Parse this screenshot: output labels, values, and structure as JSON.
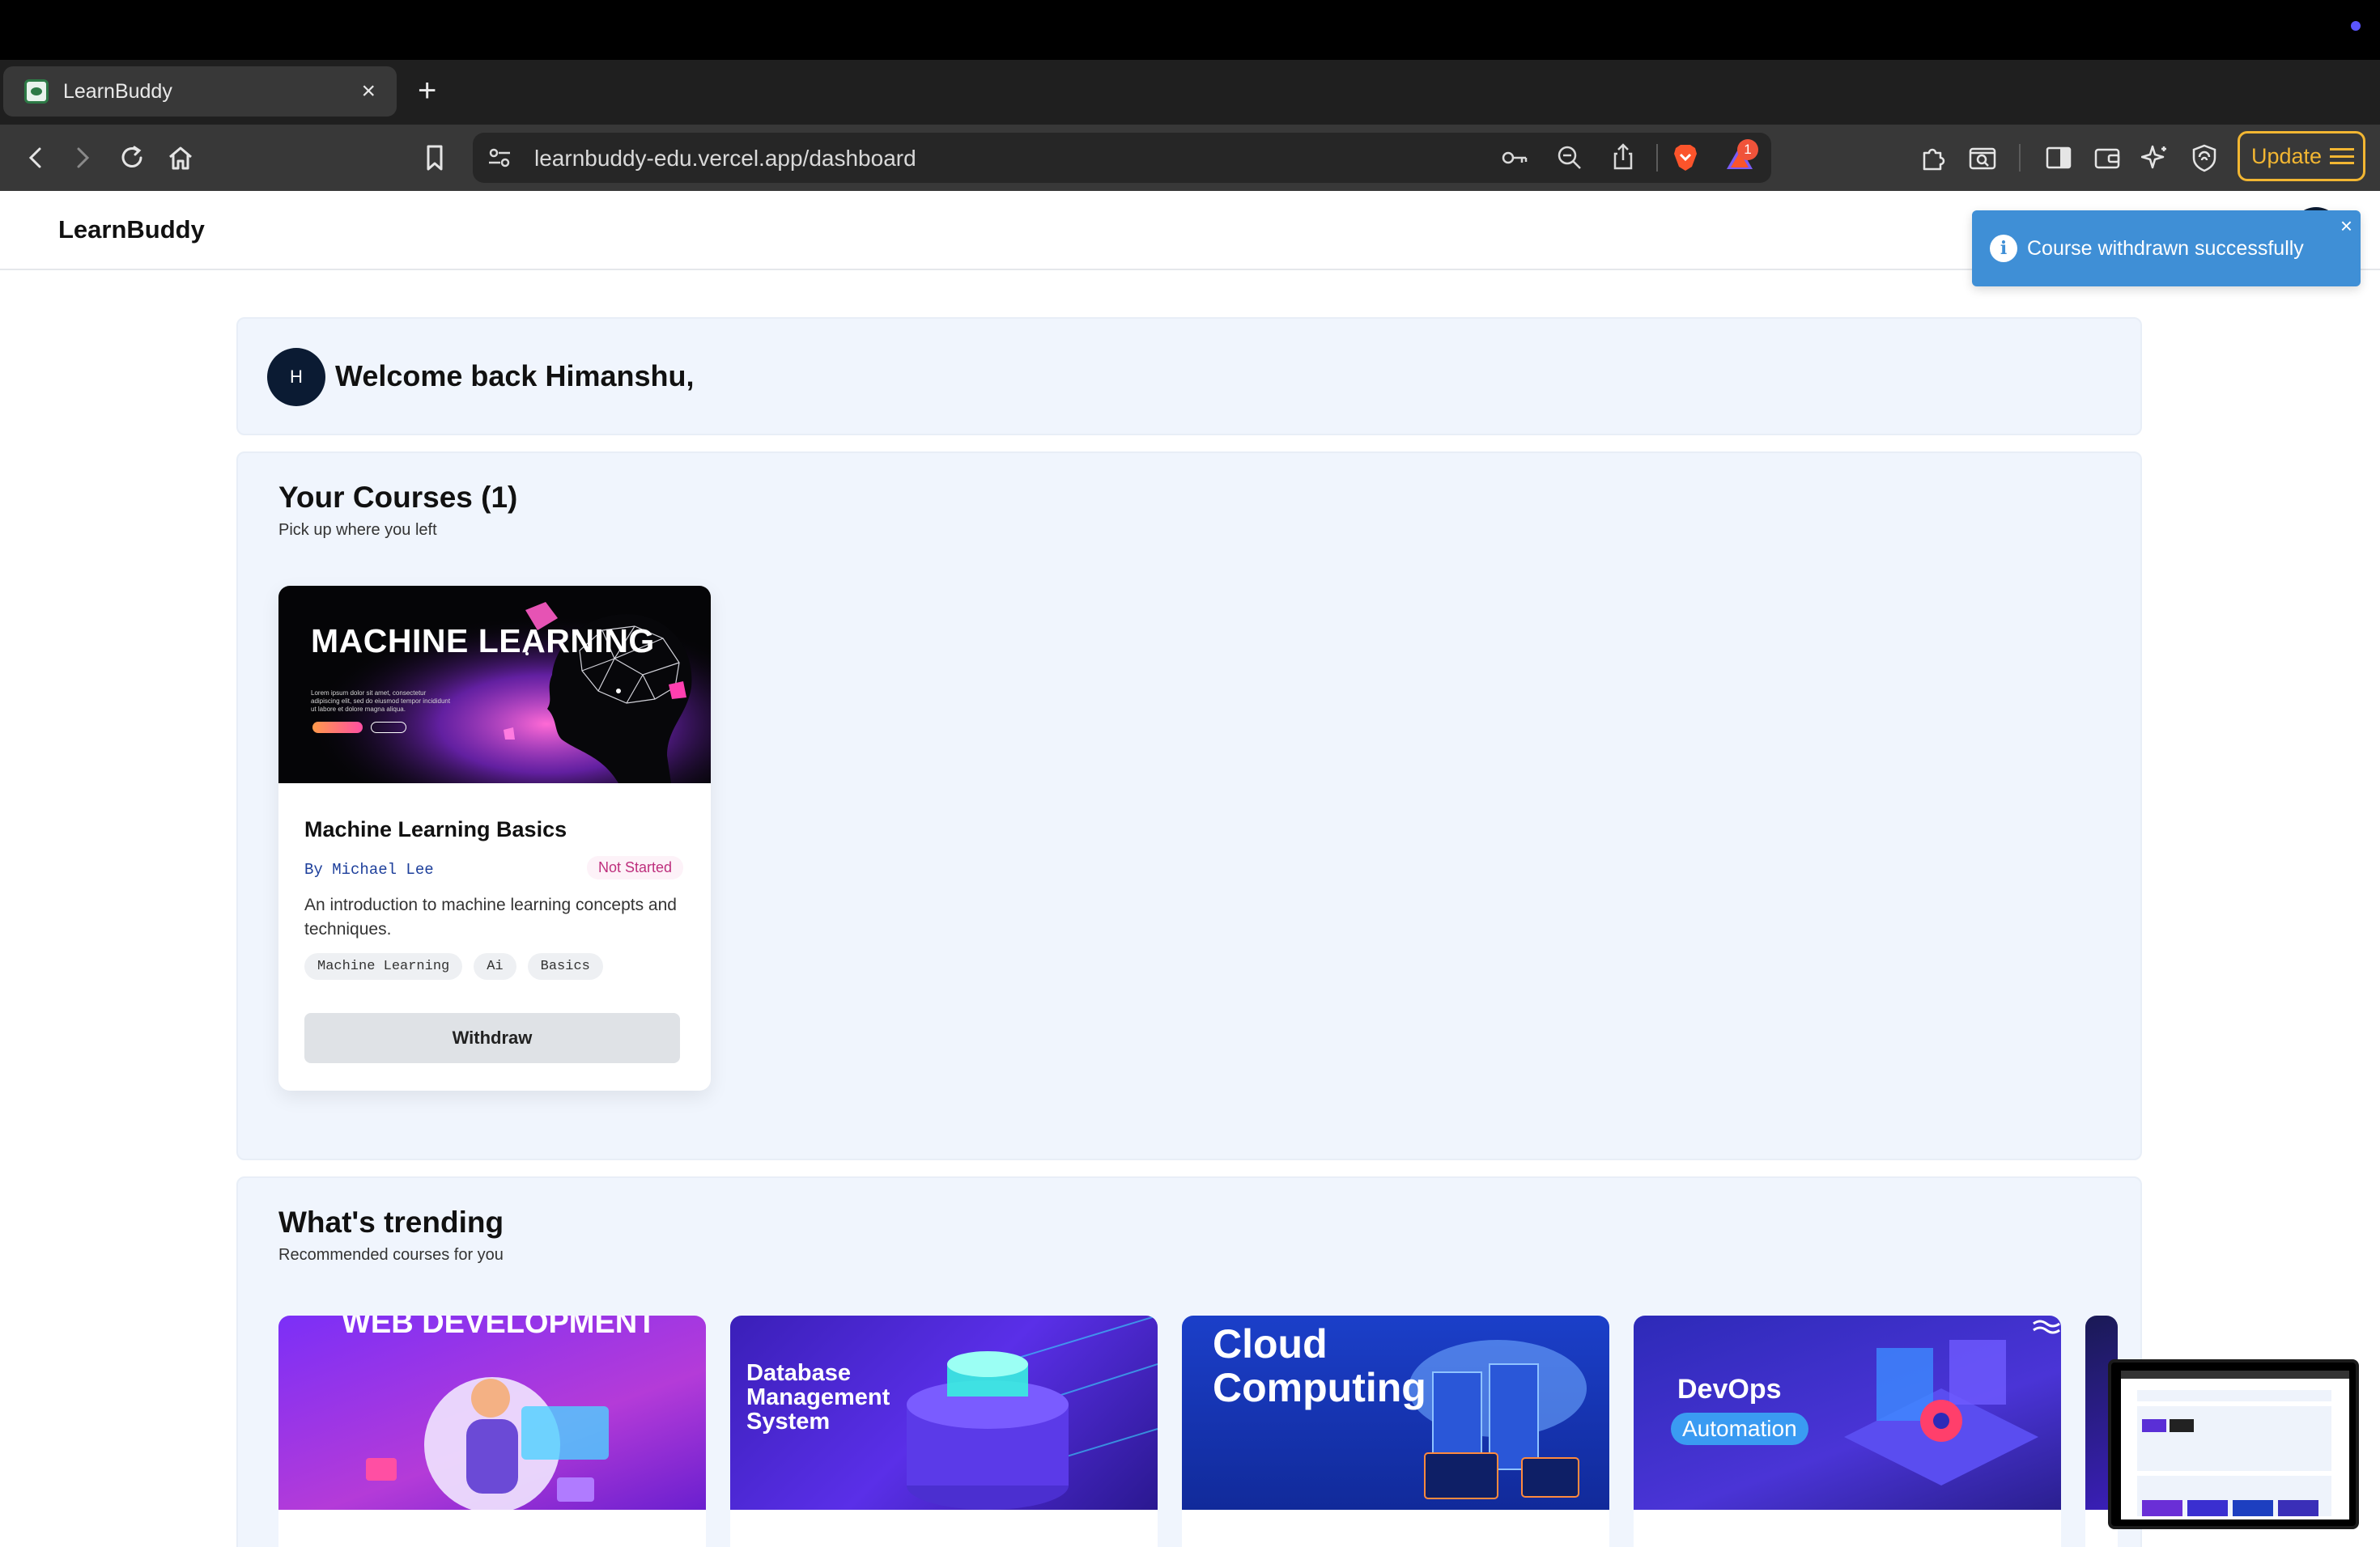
{
  "browser": {
    "tab_title": "LearnBuddy",
    "new_tab_symbol": "+",
    "close_symbol": "×",
    "url": "learnbuddy-edu.vercel.app/dashboard",
    "notification_count": "1",
    "update_label": "Update"
  },
  "app": {
    "brand": "LearnBuddy"
  },
  "toast": {
    "message": "Course withdrawn successfully",
    "close_symbol": "×",
    "info_symbol": "i"
  },
  "welcome": {
    "avatar_initial": "H",
    "greeting": "Welcome back Himanshu,"
  },
  "courses_section": {
    "title": "Your Courses (1)",
    "subtitle": "Pick up where you left",
    "courses": [
      {
        "thumbnail_text": "MACHINE LEARNING",
        "thumbnail_lorem": "Lorem ipsum dolor sit amet, consectetur adipiscing elit, sed do eiusmod tempor incididunt ut labore et dolore magna aliqua.",
        "thumbnail_btn1": "TRY FOR FREE",
        "thumbnail_btn2": "LOG IN",
        "name": "Machine Learning Basics",
        "author": "By Michael Lee",
        "status": "Not Started",
        "description": "An introduction to machine learning concepts and techniques.",
        "tags": [
          "Machine Learning",
          "Ai",
          "Basics"
        ],
        "action": "Withdraw"
      }
    ]
  },
  "trending_section": {
    "title": "What's trending",
    "subtitle": "Recommended courses for you",
    "cards": [
      {
        "thumb_text": "WEB DEVELOPMENT"
      },
      {
        "thumb_text": "Database Management System"
      },
      {
        "thumb_text": "Cloud Computing"
      },
      {
        "thumb_text": "DevOps",
        "thumb_sub": "Automation"
      }
    ]
  },
  "colors": {
    "accent": "#3f8fd6",
    "avatar_bg": "#0b1b33",
    "panel_bg": "#f0f5fd",
    "status_pink": "#be2f7d"
  }
}
